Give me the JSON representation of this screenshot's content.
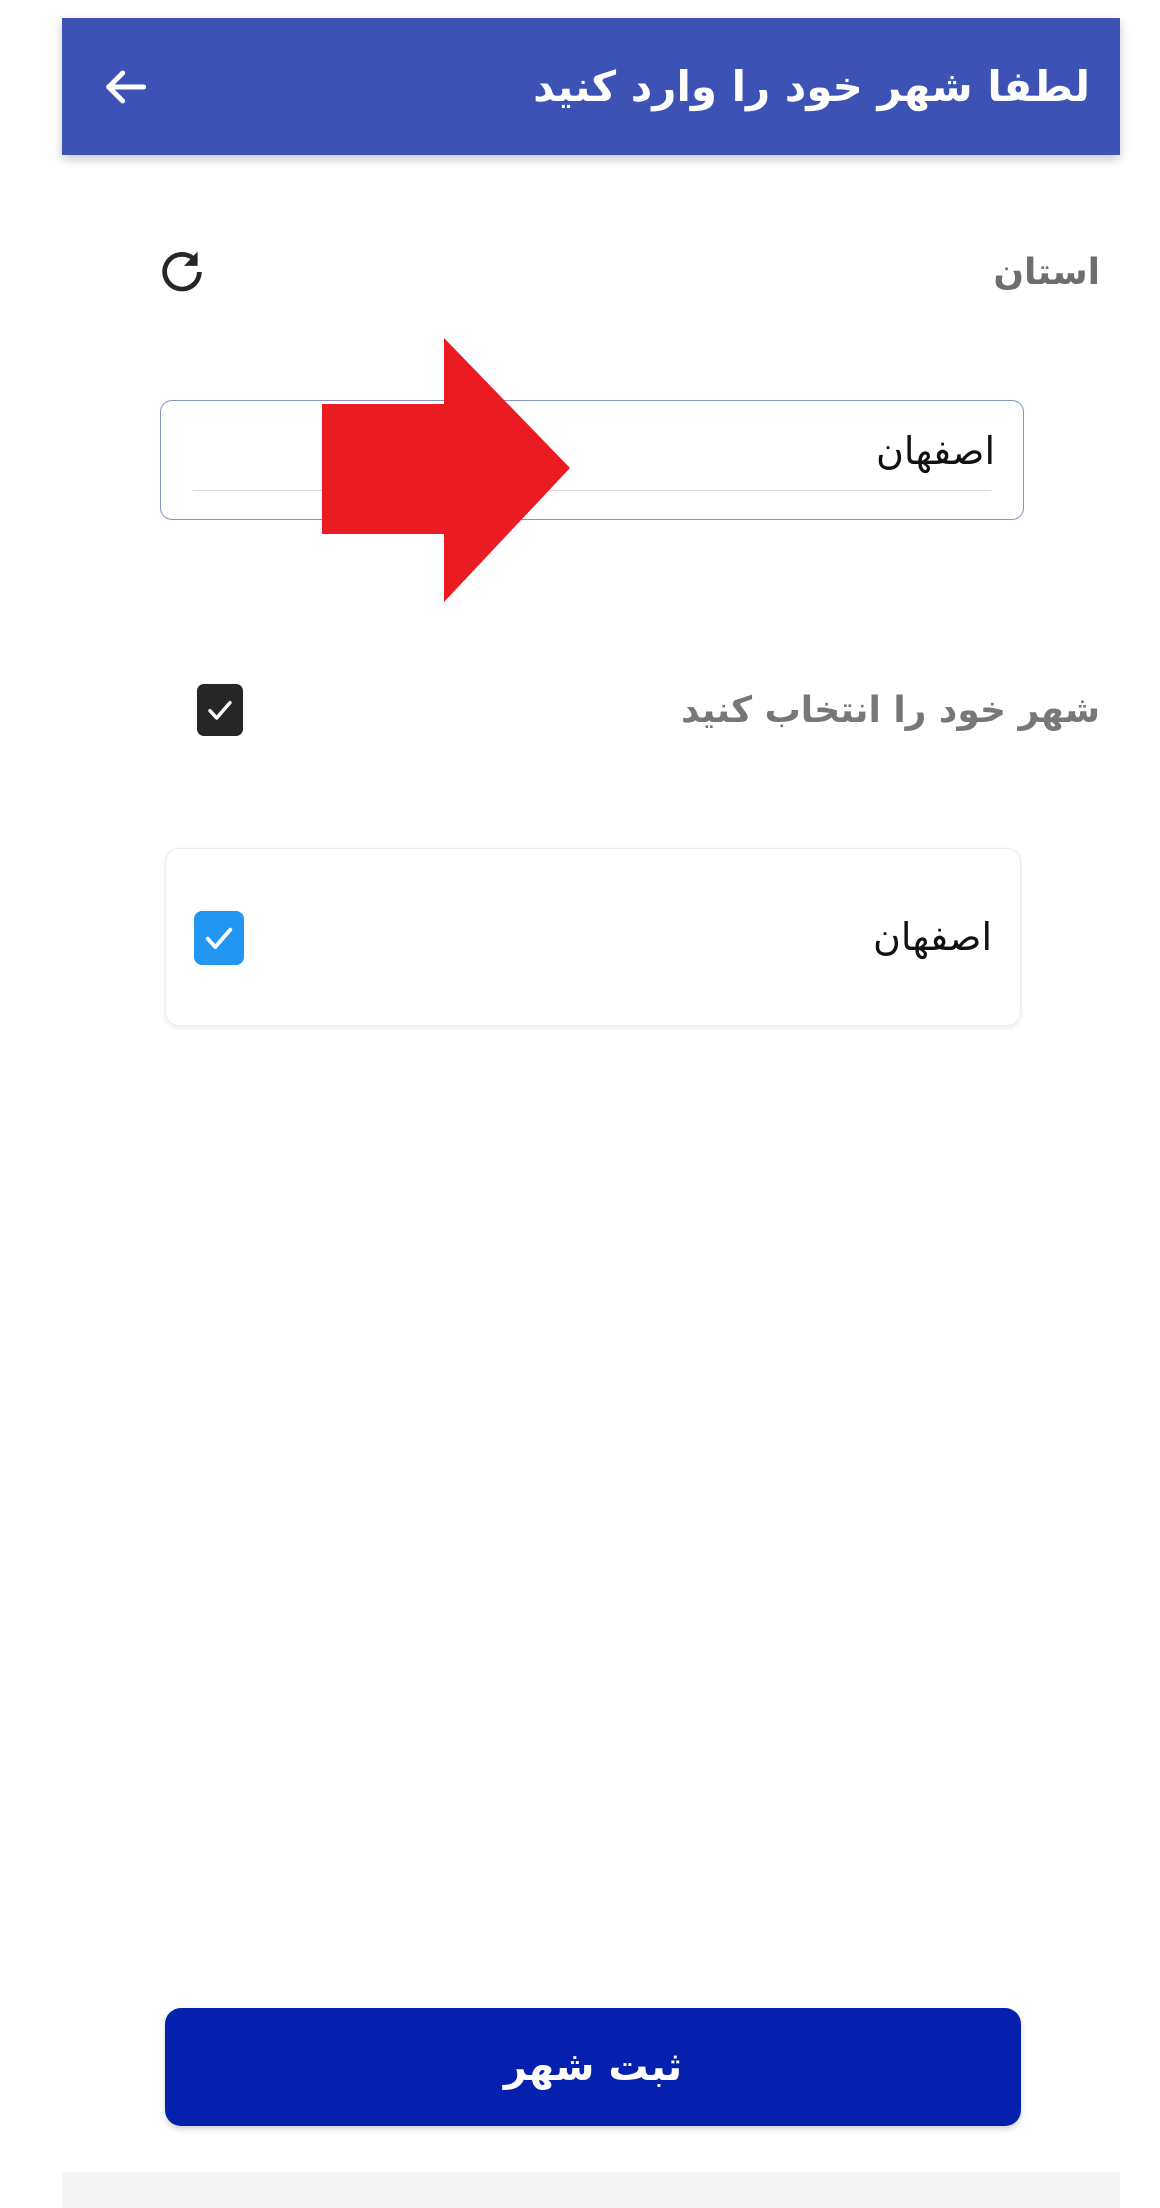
{
  "header": {
    "title": "لطفا شهر خود را وارد کنید",
    "back_icon": "arrow-left-icon",
    "background_color": "#3d52b5",
    "title_color": "#ffffff"
  },
  "province_section": {
    "label": "استان",
    "refresh_icon": "refresh-icon",
    "input": {
      "value": "اصفهان",
      "placeholder": "اصفهان",
      "border_color": "#8594bd"
    }
  },
  "annotation": {
    "arrow_icon": "arrow-right-annotation-icon",
    "color": "#ea1b23",
    "points_to": "province-input"
  },
  "select_city_section": {
    "label": "شهر خود را انتخاب کنید",
    "checkbox": {
      "checked": true,
      "color": "#262626",
      "check_icon": "check-icon"
    }
  },
  "city_list": [
    {
      "name": "اصفهان",
      "checked": true,
      "checkbox_color": "#2196f3",
      "check_icon": "check-icon"
    }
  ],
  "footer": {
    "submit_label": "ثبت شهر",
    "submit_color": "#0520ac",
    "submit_text_color": "#ffffff"
  }
}
